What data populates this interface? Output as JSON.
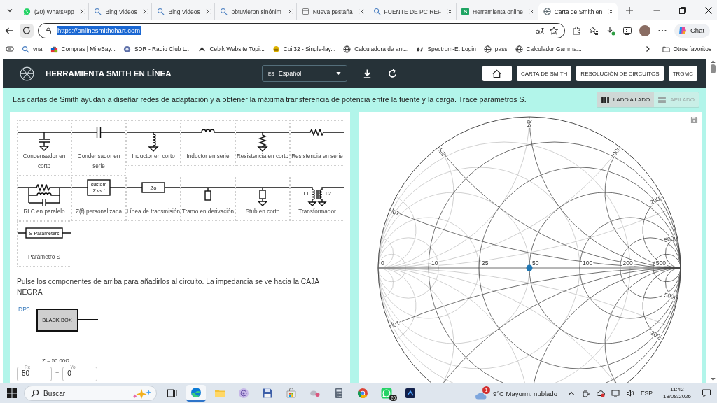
{
  "browser": {
    "tabs": [
      {
        "title": "(20) WhatsApp",
        "kind": "whatsapp",
        "selected": false
      },
      {
        "title": "Bing Videos",
        "kind": "search",
        "selected": false
      },
      {
        "title": "Bing Videos",
        "kind": "search",
        "selected": false
      },
      {
        "title": "obtuvieron sinónim",
        "kind": "search",
        "selected": false
      },
      {
        "title": "Nueva pestaña",
        "kind": "page",
        "selected": false
      },
      {
        "title": "FUENTE DE PC REF",
        "kind": "search",
        "selected": false
      },
      {
        "title": "Herramienta online",
        "kind": "letter",
        "icon_letter": "S",
        "selected": false
      },
      {
        "title": "Carta de Smith en",
        "kind": "smith",
        "selected": true
      }
    ],
    "address": {
      "url": "https://onlinesmithchart.com",
      "selected": true
    },
    "chat_button": "Chat",
    "bookmarks": [
      {
        "label": "vna",
        "kind": "search"
      },
      {
        "label": "Compras | Mi eBay...",
        "kind": "shop"
      },
      {
        "label": "SDR - Radio Club L...",
        "kind": "badge"
      },
      {
        "label": "Cebik Website Topi...",
        "kind": "emblem"
      },
      {
        "label": "Coil32 - Single-lay...",
        "kind": "coin"
      },
      {
        "label": "Calculadora de ant...",
        "kind": "globe"
      },
      {
        "label": "Spectrum-E: Login",
        "kind": "logo"
      },
      {
        "label": "pass",
        "kind": "globe"
      },
      {
        "label": "Calculador Gamma...",
        "kind": "globe"
      }
    ],
    "other_favorites": "Otros favoritos"
  },
  "app": {
    "title": "HERRAMIENTA SMITH EN LÍNEA",
    "language": {
      "code": "ES",
      "label": "Español"
    },
    "nav": [
      {
        "kind": "home"
      },
      {
        "kind": "text",
        "label": "CARTA DE SMITH"
      },
      {
        "kind": "text",
        "label": "RESOLUCIÓN DE CIRCUITOS"
      },
      {
        "kind": "text",
        "label": "TRGMC"
      }
    ],
    "intro": "Las cartas de Smith ayudan a diseñar redes de adaptación y a obtener la máxima transferencia de potencia entre la fuente y la carga. Trace parámetros S.",
    "layout_toggle": [
      {
        "label": "LADO A LADO",
        "kind": "columns",
        "selected": true
      },
      {
        "label": "APILADO",
        "kind": "rows",
        "selected": false
      }
    ],
    "components": [
      {
        "label": "Condensador en corto",
        "kind": "shunt_capacitor"
      },
      {
        "label": "Condensador en serie",
        "kind": "series_capacitor"
      },
      {
        "label": "Inductor en corto",
        "kind": "shunt_inductor"
      },
      {
        "label": "Inductor en serie",
        "kind": "series_inductor"
      },
      {
        "label": "Resistencia en corto",
        "kind": "shunt_resistor"
      },
      {
        "label": "Resistencia en serie",
        "kind": "series_resistor"
      },
      {
        "label": "RLC en paralelo",
        "kind": "parallel_rlc"
      },
      {
        "label": "Z(f) personalizada",
        "kind": "custom_z",
        "symbol_text": [
          "custom",
          "Z vs f"
        ]
      },
      {
        "label": "Línea de transmisión",
        "kind": "transmission_line",
        "symbol_text": [
          "Zo"
        ]
      },
      {
        "label": "Tramo en derivación",
        "kind": "open_stub"
      },
      {
        "label": "Stub en corto",
        "kind": "shorted_stub"
      },
      {
        "label": "Transformador",
        "kind": "transformer",
        "symbol_text": [
          "L1",
          "L2"
        ]
      },
      {
        "label": "Parámetro S",
        "kind": "s_parameters",
        "symbol_text": [
          "S-Parameters"
        ]
      }
    ],
    "instructions": "Pulse los componentes de arriba para añadirlos al circuito. La impedancia se ve hacia la CAJA NEGRA",
    "circuit": {
      "port_label": "DP0",
      "black_box_label": "BLACK BOX"
    },
    "impedance": {
      "summary": "Z = 50.00Ω",
      "operator": "+",
      "fields": [
        {
          "label": "Re",
          "value": "50"
        },
        {
          "label": "Yo",
          "value": "0"
        }
      ]
    },
    "smith_chart": {
      "resistance_labels": [
        "0",
        "10",
        "25",
        "50",
        "100",
        "200",
        "500"
      ],
      "reactance_labels": [
        "50j",
        "25j",
        "100j",
        "10j",
        "200j",
        "500j",
        "-10j",
        "-500j",
        "-200j"
      ]
    }
  },
  "taskbar": {
    "search_placeholder": "Buscar",
    "apps": [
      {
        "kind": "taskview",
        "active": false
      },
      {
        "kind": "edge",
        "active": true
      },
      {
        "kind": "folder",
        "active": false
      },
      {
        "kind": "orb",
        "active": false
      },
      {
        "kind": "floppy",
        "active": false
      },
      {
        "kind": "store",
        "active": false
      },
      {
        "kind": "misc",
        "active": false
      },
      {
        "kind": "calculator",
        "active": false
      },
      {
        "kind": "chrome",
        "active": false
      },
      {
        "kind": "whatsapp",
        "active": false,
        "badge": "20"
      },
      {
        "kind": "square",
        "active": false
      }
    ],
    "weather": {
      "badge": "1",
      "text": "9°C Mayorm. nublado"
    },
    "language": "ESP",
    "time": "11:42",
    "date": "18/08/2026"
  }
}
